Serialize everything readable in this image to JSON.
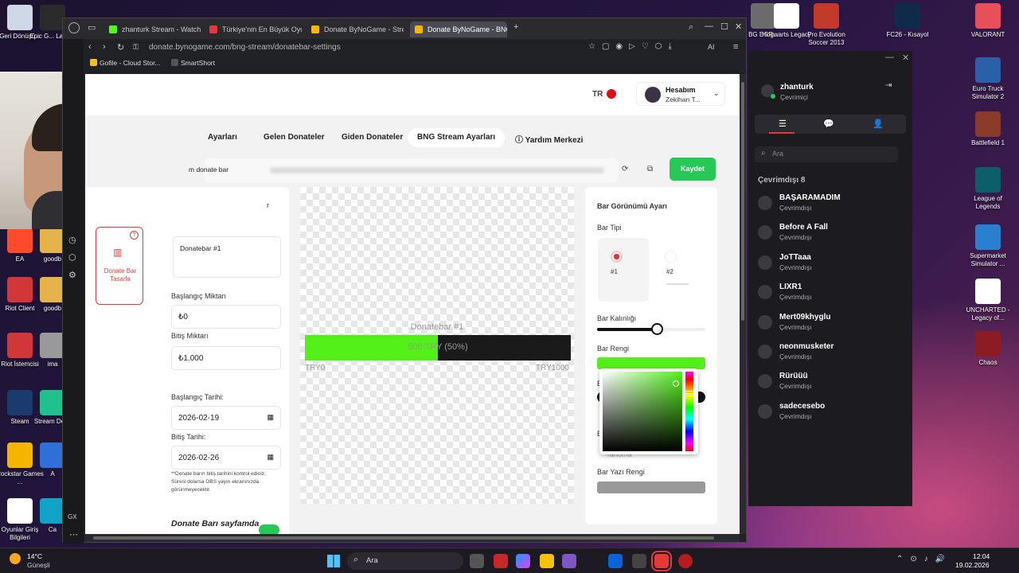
{
  "desktop": {
    "icons_left": [
      {
        "label": "Geri Dönüşü...",
        "color": "#cfd8e6"
      },
      {
        "label": "EA",
        "color": "#ff4b2b"
      },
      {
        "label": "Riot Client",
        "color": "#d13639"
      },
      {
        "label": "Riot İstemcisi",
        "color": "#d13639"
      },
      {
        "label": "Steam",
        "color": "#1b3b6f"
      },
      {
        "label": "Rockstar Games ...",
        "color": "#f5b400"
      },
      {
        "label": "Oyunlar Giriş Bilgileri",
        "color": "#ffffff"
      }
    ],
    "icons_col2": [
      {
        "label": "Epic G... Laun...",
        "color": "#2a2a2a"
      },
      {
        "label": "goodb",
        "color": "#e6b34a"
      },
      {
        "label": "goodb",
        "color": "#e6b34a"
      },
      {
        "label": "ima",
        "color": "#999999"
      },
      {
        "label": "Stream Desk",
        "color": "#1fc28d"
      },
      {
        "label": "A",
        "color": "#2e6fd8"
      },
      {
        "label": "Ca",
        "color": "#0fa3c8"
      }
    ],
    "icons_top": [
      {
        "label": "BG EGR...",
        "color": "#6b6b6b"
      },
      {
        "label": "Hogwarts Legacy",
        "color": "#ffffff"
      },
      {
        "label": "Pro Evolution Soccer 2013",
        "color": "#c0392b"
      },
      {
        "label": "FC26 - Kısayol",
        "color": "#0f2a4a"
      }
    ],
    "icons_right": [
      {
        "label": "VALORANT",
        "color": "#e94f5a"
      },
      {
        "label": "Euro Truck Simulator 2",
        "color": "#2b5fa8"
      },
      {
        "label": "Battlefield 1",
        "color": "#8a3b2b"
      },
      {
        "label": "League of Legends",
        "color": "#0d5d6b"
      },
      {
        "label": "Supermarket Simulator ...",
        "color": "#2a7fd1"
      },
      {
        "label": "UNCHARTED - Legacy of...",
        "color": "#ffffff"
      },
      {
        "label": "Chaos",
        "color": "#8b1c24"
      }
    ]
  },
  "browser": {
    "tabs": [
      {
        "label": "zhanturk Stream - Watch L",
        "fav": "#53fc18"
      },
      {
        "label": "Türkiye'nin En Büyük Oyu",
        "fav": "#e5383b"
      },
      {
        "label": "Donate ByNoGame - Strea",
        "fav": "#ffb400"
      },
      {
        "label": "Donate ByNoGame - BNG",
        "fav": "#ffb400"
      }
    ],
    "url": "donate.bynogame.com/bng-stream/donatebar-settings",
    "bookmarks": [
      "Gofile - Cloud Stor...",
      "SmartShort"
    ]
  },
  "site": {
    "lang": "TR",
    "account": {
      "title": "Hesabım",
      "subtitle": "Zekihan T..."
    },
    "nav": [
      "Ayarları",
      "Gelen Donateler",
      "Giden Donateler",
      "BNG Stream Ayarları",
      "Yardım Merkezi"
    ],
    "url_label": "m donate bar",
    "save_label": "Kaydet",
    "side_card": {
      "partial": "r",
      "label": "Donate Bar Tasarla"
    },
    "form": {
      "name_value": "Donatebar #1",
      "start_amount_label": "Başlangıç Miktarı",
      "start_amount": "₺0",
      "end_amount_label": "Bitiş Miktarı",
      "end_amount": "₺1.000",
      "start_date_label": "Başlangıç Tarihi:",
      "start_date": "2026-02-19",
      "end_date_label": "Bitiş Tarihi:",
      "end_date": "2026-02-26",
      "note": "**Donate barın bitiş tarihini kontrol ediniz. Süresi dolarsa OBS yayın ekranınızda görünmeyecektir.",
      "toggle_label": "Donate Barı sayfamda"
    },
    "preview": {
      "title": "Donatebar #1",
      "progress_text": "500 TRY (50%)",
      "progress": 0.5,
      "min": "TRY0",
      "max": "TRY1000",
      "fill_color": "#52f018",
      "track_color": "#1a1a1a"
    },
    "appearance": {
      "title": "Bar Görünümü Ayarı",
      "type_label": "Bar Tipi",
      "type1": "#1",
      "type2": "#2",
      "thickness_label": "Bar Kalınlığı",
      "thickness": 0.55,
      "color_label": "Bar Rengi",
      "bar_color": "#52f018",
      "partial_b1": "B",
      "partial_b2": "B",
      "partial_text": "rahoma",
      "text_color_label": "Bar Yazı Rengi"
    }
  },
  "friends": {
    "user": "zhanturk",
    "status": "Çevrimiçi",
    "search_placeholder": "Ara",
    "online_label": "Çevrimdışı 8",
    "list": [
      {
        "name": "BAŞARAMADIM",
        "status": "Çevrimdışı"
      },
      {
        "name": "Before A Fall",
        "status": "Çevrimdışı"
      },
      {
        "name": "JoTTaaa",
        "status": "Çevrimdışı"
      },
      {
        "name": "LIXR1",
        "status": "Çevrimdışı"
      },
      {
        "name": "Mert09khyglu",
        "status": "Çevrimdışı"
      },
      {
        "name": "neonmusketer",
        "status": "Çevrimdışı"
      },
      {
        "name": "Rürüüü",
        "status": "Çevrimdışı"
      },
      {
        "name": "sadecesebo",
        "status": "Çevrimdışı"
      }
    ]
  },
  "taskbar": {
    "weather_temp": "14°C",
    "weather_text": "Güneşli",
    "search": "Ara",
    "time": "12:04",
    "date": "19.02.2026"
  }
}
